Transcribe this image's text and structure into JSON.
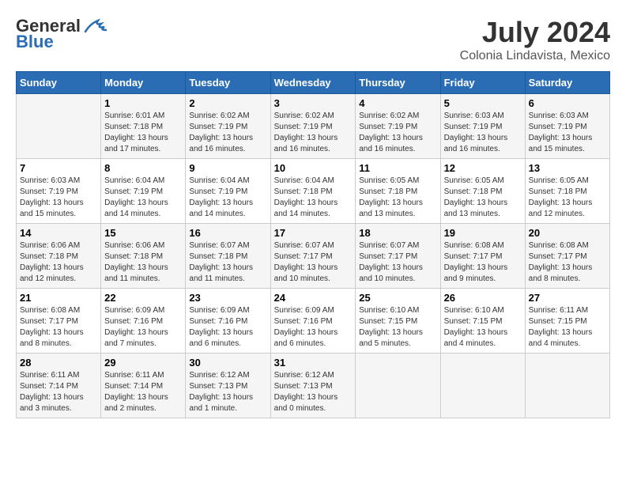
{
  "header": {
    "logo_general": "General",
    "logo_blue": "Blue",
    "month_year": "July 2024",
    "location": "Colonia Lindavista, Mexico"
  },
  "weekdays": [
    "Sunday",
    "Monday",
    "Tuesday",
    "Wednesday",
    "Thursday",
    "Friday",
    "Saturday"
  ],
  "weeks": [
    [
      {
        "day": "",
        "info": ""
      },
      {
        "day": "1",
        "info": "Sunrise: 6:01 AM\nSunset: 7:18 PM\nDaylight: 13 hours\nand 17 minutes."
      },
      {
        "day": "2",
        "info": "Sunrise: 6:02 AM\nSunset: 7:19 PM\nDaylight: 13 hours\nand 16 minutes."
      },
      {
        "day": "3",
        "info": "Sunrise: 6:02 AM\nSunset: 7:19 PM\nDaylight: 13 hours\nand 16 minutes."
      },
      {
        "day": "4",
        "info": "Sunrise: 6:02 AM\nSunset: 7:19 PM\nDaylight: 13 hours\nand 16 minutes."
      },
      {
        "day": "5",
        "info": "Sunrise: 6:03 AM\nSunset: 7:19 PM\nDaylight: 13 hours\nand 16 minutes."
      },
      {
        "day": "6",
        "info": "Sunrise: 6:03 AM\nSunset: 7:19 PM\nDaylight: 13 hours\nand 15 minutes."
      }
    ],
    [
      {
        "day": "7",
        "info": "Sunrise: 6:03 AM\nSunset: 7:19 PM\nDaylight: 13 hours\nand 15 minutes."
      },
      {
        "day": "8",
        "info": "Sunrise: 6:04 AM\nSunset: 7:19 PM\nDaylight: 13 hours\nand 14 minutes."
      },
      {
        "day": "9",
        "info": "Sunrise: 6:04 AM\nSunset: 7:19 PM\nDaylight: 13 hours\nand 14 minutes."
      },
      {
        "day": "10",
        "info": "Sunrise: 6:04 AM\nSunset: 7:18 PM\nDaylight: 13 hours\nand 14 minutes."
      },
      {
        "day": "11",
        "info": "Sunrise: 6:05 AM\nSunset: 7:18 PM\nDaylight: 13 hours\nand 13 minutes."
      },
      {
        "day": "12",
        "info": "Sunrise: 6:05 AM\nSunset: 7:18 PM\nDaylight: 13 hours\nand 13 minutes."
      },
      {
        "day": "13",
        "info": "Sunrise: 6:05 AM\nSunset: 7:18 PM\nDaylight: 13 hours\nand 12 minutes."
      }
    ],
    [
      {
        "day": "14",
        "info": "Sunrise: 6:06 AM\nSunset: 7:18 PM\nDaylight: 13 hours\nand 12 minutes."
      },
      {
        "day": "15",
        "info": "Sunrise: 6:06 AM\nSunset: 7:18 PM\nDaylight: 13 hours\nand 11 minutes."
      },
      {
        "day": "16",
        "info": "Sunrise: 6:07 AM\nSunset: 7:18 PM\nDaylight: 13 hours\nand 11 minutes."
      },
      {
        "day": "17",
        "info": "Sunrise: 6:07 AM\nSunset: 7:17 PM\nDaylight: 13 hours\nand 10 minutes."
      },
      {
        "day": "18",
        "info": "Sunrise: 6:07 AM\nSunset: 7:17 PM\nDaylight: 13 hours\nand 10 minutes."
      },
      {
        "day": "19",
        "info": "Sunrise: 6:08 AM\nSunset: 7:17 PM\nDaylight: 13 hours\nand 9 minutes."
      },
      {
        "day": "20",
        "info": "Sunrise: 6:08 AM\nSunset: 7:17 PM\nDaylight: 13 hours\nand 8 minutes."
      }
    ],
    [
      {
        "day": "21",
        "info": "Sunrise: 6:08 AM\nSunset: 7:17 PM\nDaylight: 13 hours\nand 8 minutes."
      },
      {
        "day": "22",
        "info": "Sunrise: 6:09 AM\nSunset: 7:16 PM\nDaylight: 13 hours\nand 7 minutes."
      },
      {
        "day": "23",
        "info": "Sunrise: 6:09 AM\nSunset: 7:16 PM\nDaylight: 13 hours\nand 6 minutes."
      },
      {
        "day": "24",
        "info": "Sunrise: 6:09 AM\nSunset: 7:16 PM\nDaylight: 13 hours\nand 6 minutes."
      },
      {
        "day": "25",
        "info": "Sunrise: 6:10 AM\nSunset: 7:15 PM\nDaylight: 13 hours\nand 5 minutes."
      },
      {
        "day": "26",
        "info": "Sunrise: 6:10 AM\nSunset: 7:15 PM\nDaylight: 13 hours\nand 4 minutes."
      },
      {
        "day": "27",
        "info": "Sunrise: 6:11 AM\nSunset: 7:15 PM\nDaylight: 13 hours\nand 4 minutes."
      }
    ],
    [
      {
        "day": "28",
        "info": "Sunrise: 6:11 AM\nSunset: 7:14 PM\nDaylight: 13 hours\nand 3 minutes."
      },
      {
        "day": "29",
        "info": "Sunrise: 6:11 AM\nSunset: 7:14 PM\nDaylight: 13 hours\nand 2 minutes."
      },
      {
        "day": "30",
        "info": "Sunrise: 6:12 AM\nSunset: 7:13 PM\nDaylight: 13 hours\nand 1 minute."
      },
      {
        "day": "31",
        "info": "Sunrise: 6:12 AM\nSunset: 7:13 PM\nDaylight: 13 hours\nand 0 minutes."
      },
      {
        "day": "",
        "info": ""
      },
      {
        "day": "",
        "info": ""
      },
      {
        "day": "",
        "info": ""
      }
    ]
  ]
}
